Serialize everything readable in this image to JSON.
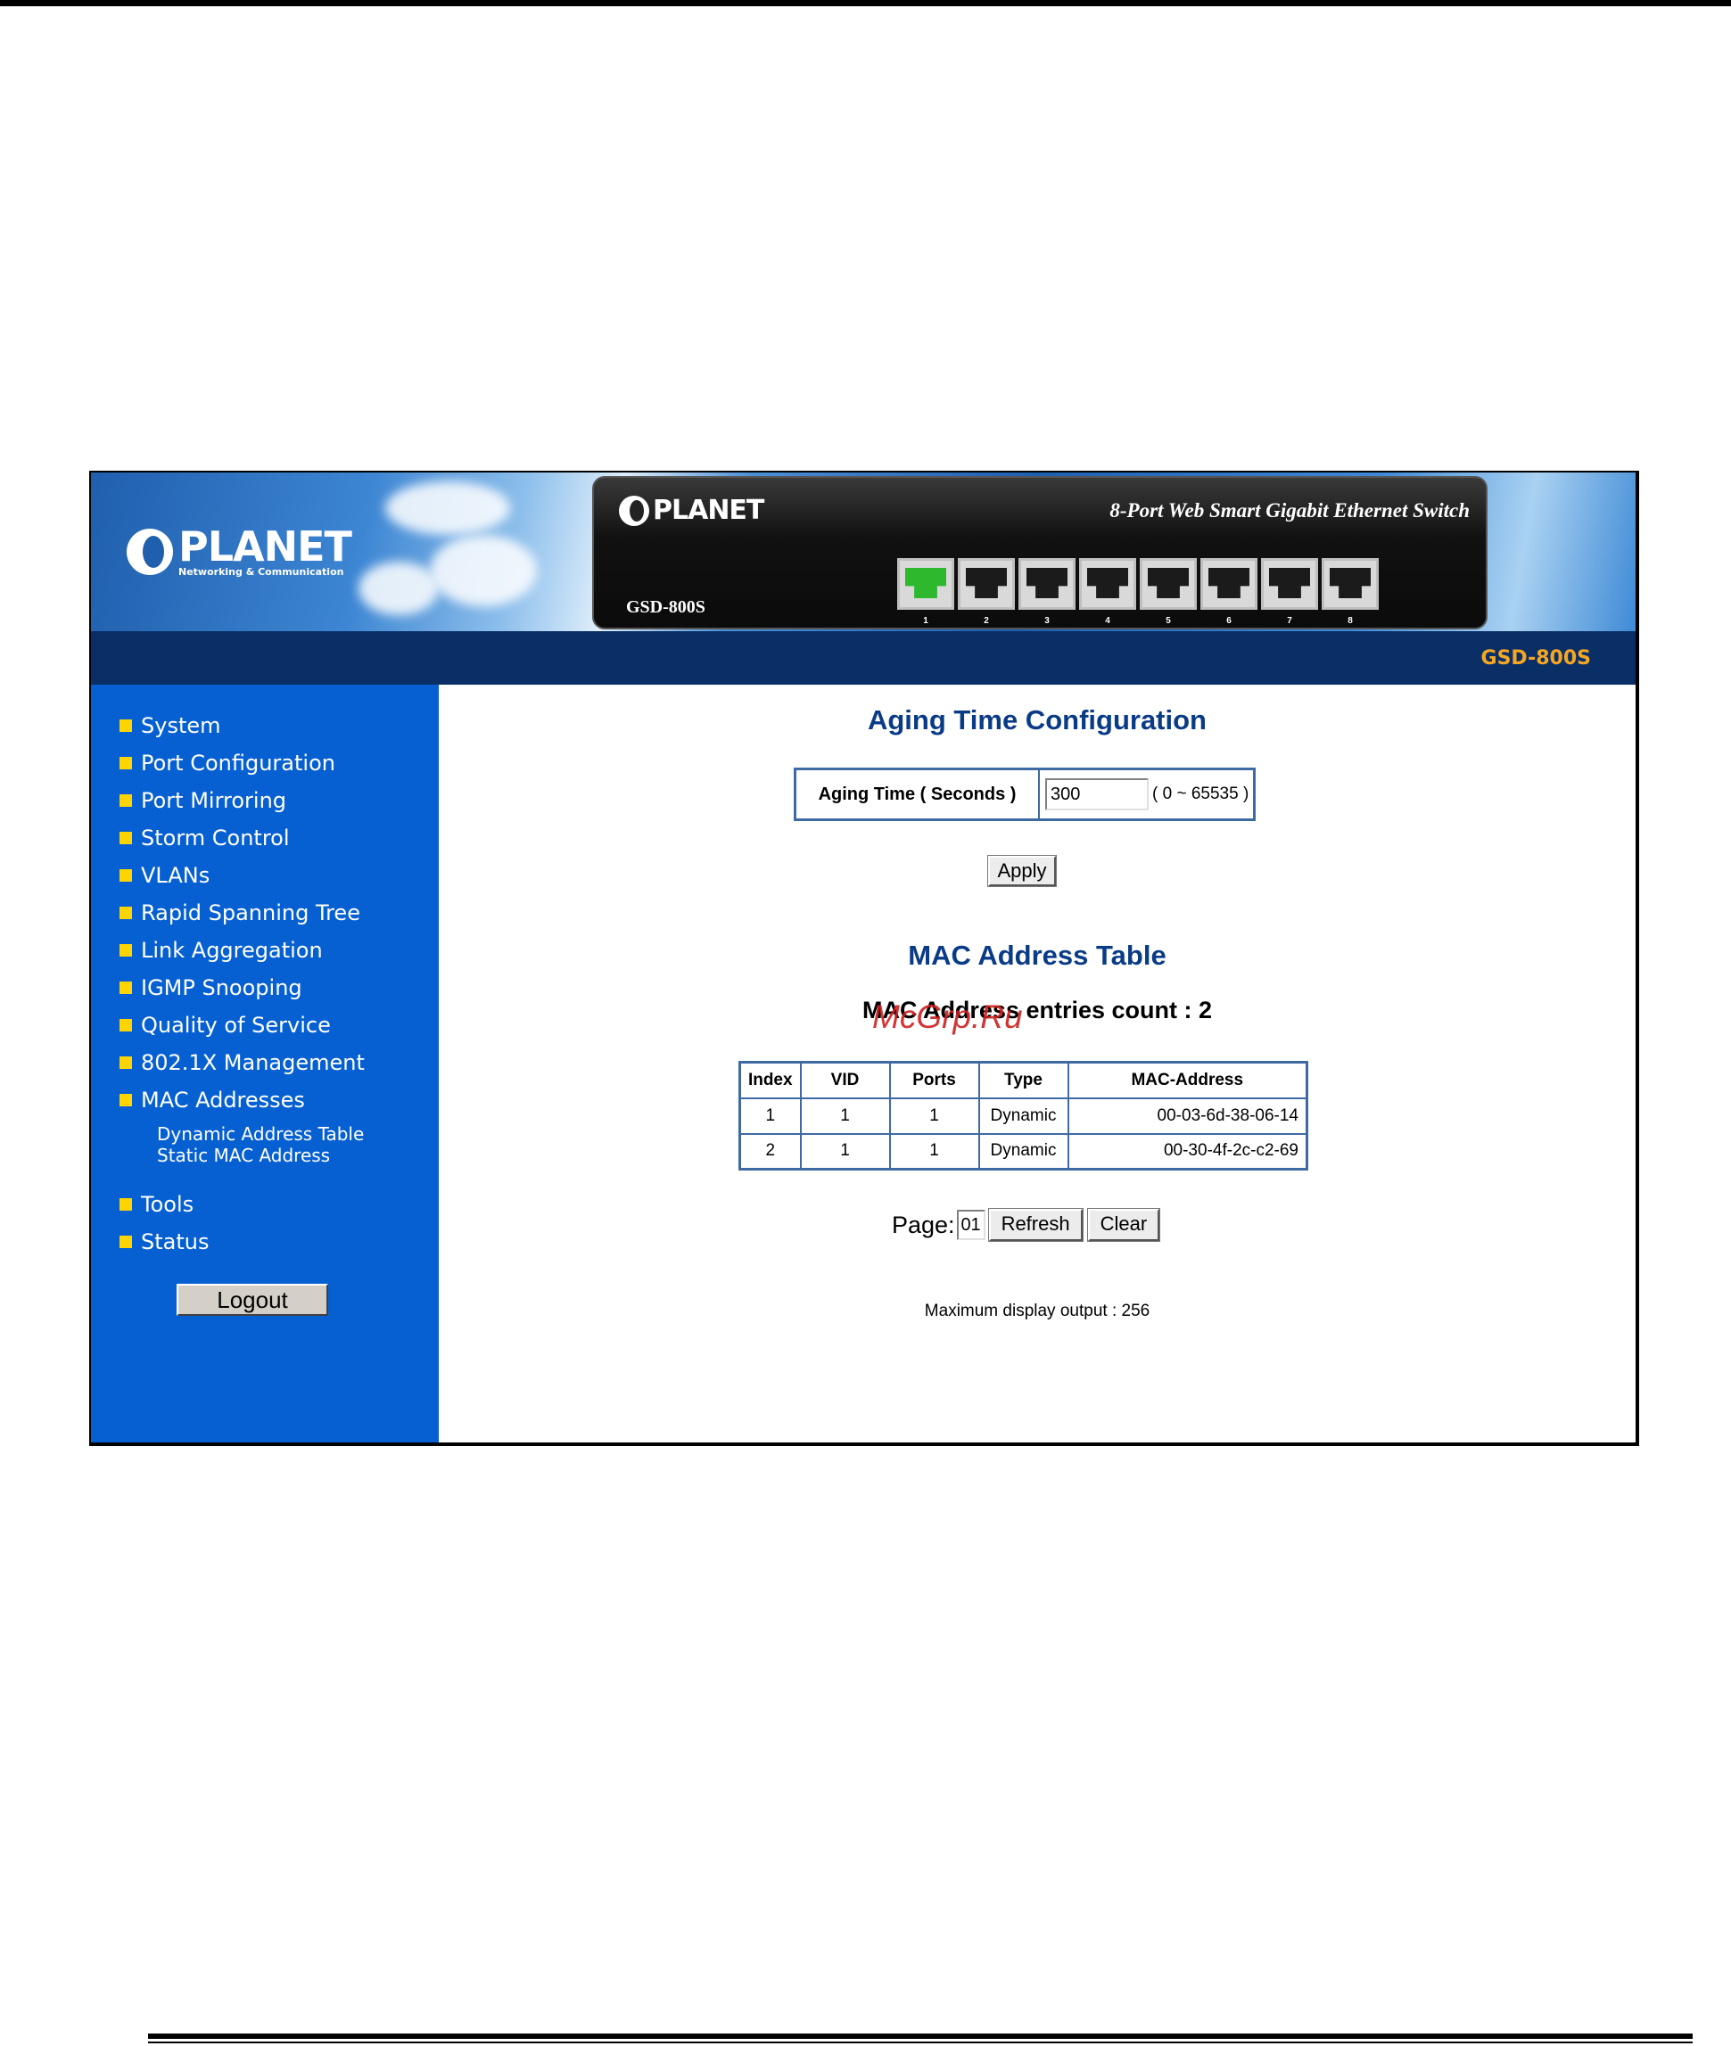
{
  "header": {
    "brand": "PLANET",
    "brand_sub": "Networking & Communication",
    "device_title": "8-Port Web Smart Gigabit Ethernet Switch",
    "device_model": "GSD-800S",
    "bar_model": "GSD-800S",
    "ports": [
      {
        "num": "1",
        "active": true
      },
      {
        "num": "2",
        "active": false
      },
      {
        "num": "3",
        "active": false
      },
      {
        "num": "4",
        "active": false
      },
      {
        "num": "5",
        "active": false
      },
      {
        "num": "6",
        "active": false
      },
      {
        "num": "7",
        "active": false
      },
      {
        "num": "8",
        "active": false
      }
    ]
  },
  "sidebar": {
    "items": [
      {
        "label": "System"
      },
      {
        "label": "Port Configuration"
      },
      {
        "label": "Port Mirroring"
      },
      {
        "label": "Storm Control"
      },
      {
        "label": "VLANs"
      },
      {
        "label": "Rapid Spanning Tree"
      },
      {
        "label": "Link Aggregation"
      },
      {
        "label": "IGMP Snooping"
      },
      {
        "label": "Quality of Service"
      },
      {
        "label": "802.1X Management"
      },
      {
        "label": "MAC Addresses"
      },
      {
        "label": "Tools"
      },
      {
        "label": "Status"
      }
    ],
    "submenu": [
      "Dynamic Address Table",
      "Static MAC Address"
    ],
    "logout_label": "Logout"
  },
  "aging": {
    "title": "Aging Time Configuration",
    "label": "Aging Time ( Seconds )",
    "value": "300",
    "range": "( 0 ~ 65535 )",
    "apply_label": "Apply"
  },
  "mac_table": {
    "title": "MAC Address Table",
    "entries_label": "MAC Address entries count : 2",
    "columns": [
      "Index",
      "VID",
      "Ports",
      "Type",
      "MAC-Address"
    ],
    "rows": [
      [
        "1",
        "1",
        "1",
        "Dynamic",
        "00-03-6d-38-06-14"
      ],
      [
        "2",
        "1",
        "1",
        "Dynamic",
        "00-30-4f-2c-c2-69"
      ]
    ],
    "page_label": "Page:",
    "page_value": "01",
    "refresh_label": "Refresh",
    "clear_label": "Clear",
    "max_output": "Maximum display output : 256"
  },
  "watermark": "McGrp.Ru",
  "colors": {
    "sidebar": "#0660d2",
    "header_bar": "#0a2f66",
    "title": "#0a3b87",
    "model_accent": "#f5a623",
    "bullet": "#ffd400",
    "watermark": "#cc2020"
  }
}
